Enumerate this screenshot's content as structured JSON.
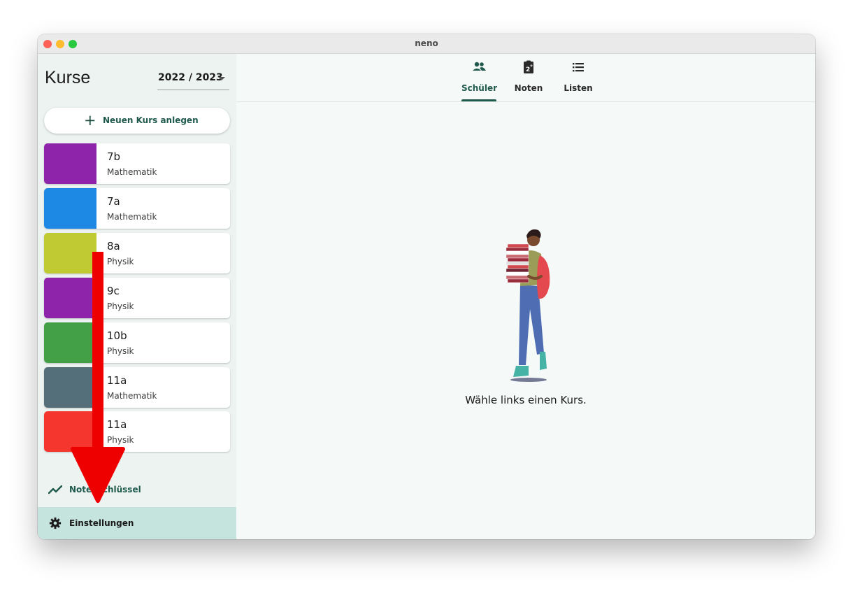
{
  "window": {
    "title": "neno"
  },
  "sidebar": {
    "title": "Kurse",
    "year": "2022 / 2023",
    "new_course_label": "Neuen Kurs anlegen",
    "courses": [
      {
        "name": "7b",
        "subject": "Mathematik",
        "color": "#8e24aa"
      },
      {
        "name": "7a",
        "subject": "Mathematik",
        "color": "#1e88e5"
      },
      {
        "name": "8a",
        "subject": "Physik",
        "color": "#c0ca33"
      },
      {
        "name": "9c",
        "subject": "Physik",
        "color": "#8e24aa"
      },
      {
        "name": "10b",
        "subject": "Physik",
        "color": "#43a047"
      },
      {
        "name": "11a",
        "subject": "Mathematik",
        "color": "#546e7a"
      },
      {
        "name": "11a",
        "subject": "Physik",
        "color": "#f4362e"
      }
    ],
    "grade_key_label": "Notenschlüssel",
    "settings_label": "Einstellungen"
  },
  "tabs": [
    {
      "label": "Schüler",
      "icon": "people-icon",
      "active": true
    },
    {
      "label": "Noten",
      "icon": "grade-clipboard-icon",
      "active": false
    },
    {
      "label": "Listen",
      "icon": "list-icon",
      "active": false
    }
  ],
  "main": {
    "empty_message": "Wähle links einen Kurs."
  },
  "colors": {
    "accent": "#1f5a4c",
    "annotation_arrow": "#ee0000"
  }
}
